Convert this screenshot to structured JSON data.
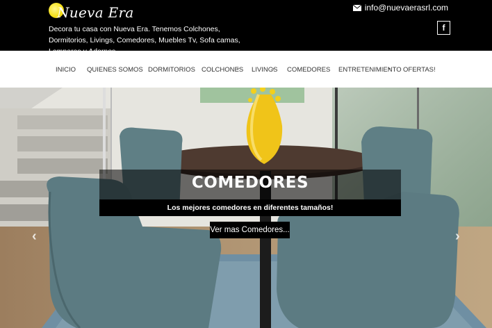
{
  "header": {
    "logo_text": "Nueva Era",
    "tagline": "Decora tu casa con Nueva Era. Tenemos Colchones, Dormitorios, Livings, Comedores, Muebles Tv, Sofa camas, Lamparas y Adornos.",
    "email": "info@nuevaerasrl.com",
    "facebook_label": "f"
  },
  "nav": {
    "items": [
      {
        "label": "INICIO"
      },
      {
        "label": "QUIENES SOMOS"
      },
      {
        "label": "DORMITORIOS"
      },
      {
        "label": "COLCHONES"
      },
      {
        "label": "LIVINGS"
      },
      {
        "label": "COMEDORES"
      },
      {
        "label": "ENTRETENIMIENTO"
      },
      {
        "label": "OFERTAS!"
      }
    ],
    "caret": "⌄"
  },
  "hero": {
    "title": "COMEDORES",
    "subtitle": "Los mejores comedores en diferentes tamaños!",
    "cta_label": "Ver mas Comedores...",
    "prev_arrow": "‹",
    "next_arrow": "›"
  },
  "colors": {
    "topbar": "#000000",
    "chair": "#5f7f85",
    "vase": "#f0c419"
  }
}
